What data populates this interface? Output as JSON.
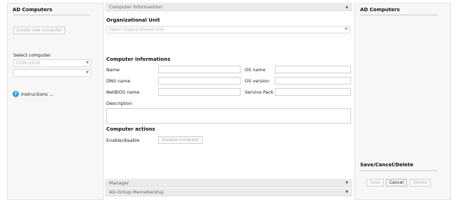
{
  "left_panel": {
    "title": "AD Computers",
    "create_button": "Create new computer",
    "select_label": "Select computer",
    "domain_select": "DOM.LOCAL",
    "computer_select": "",
    "instructions": "Instructions ..."
  },
  "center": {
    "computer_info_bar": "Computer Informantion",
    "ou_header": "Organizational Unit",
    "ou_placeholder": "Select Organizational Unit",
    "info_header": "Computer informations",
    "fields": {
      "name": "Name",
      "os_name": "OS name",
      "dns_name": "DNS name",
      "os_version": "OS version",
      "netbios_name": "NetBIOS name",
      "service_pack": "Service Pack",
      "description": "Description"
    },
    "values": {
      "name": "",
      "os_name": "",
      "dns_name": "",
      "os_version": "",
      "netbios_name": "",
      "service_pack": "",
      "description": ""
    },
    "actions_header": "Computer actions",
    "enable_label": "Enable/disable",
    "disable_button": "Disable computer",
    "manager_bar": "Manager",
    "group_bar": "AD-Group Memebership"
  },
  "right_panel": {
    "title": "AD Computers",
    "scd_title": "Save/Cancel/Delete",
    "save_button": "Save",
    "cancel_button": "Cancel",
    "delete_button": "Delete"
  },
  "icons": {
    "help": "question-circle-icon",
    "collapse": "triangle-up-icon",
    "expand": "triangle-down-icon",
    "dropdown": "chevron-down-icon"
  },
  "colors": {
    "accent": "#2d9be0",
    "panel_bg": "#f7f7f7",
    "bar_bg": "#ebebeb"
  }
}
